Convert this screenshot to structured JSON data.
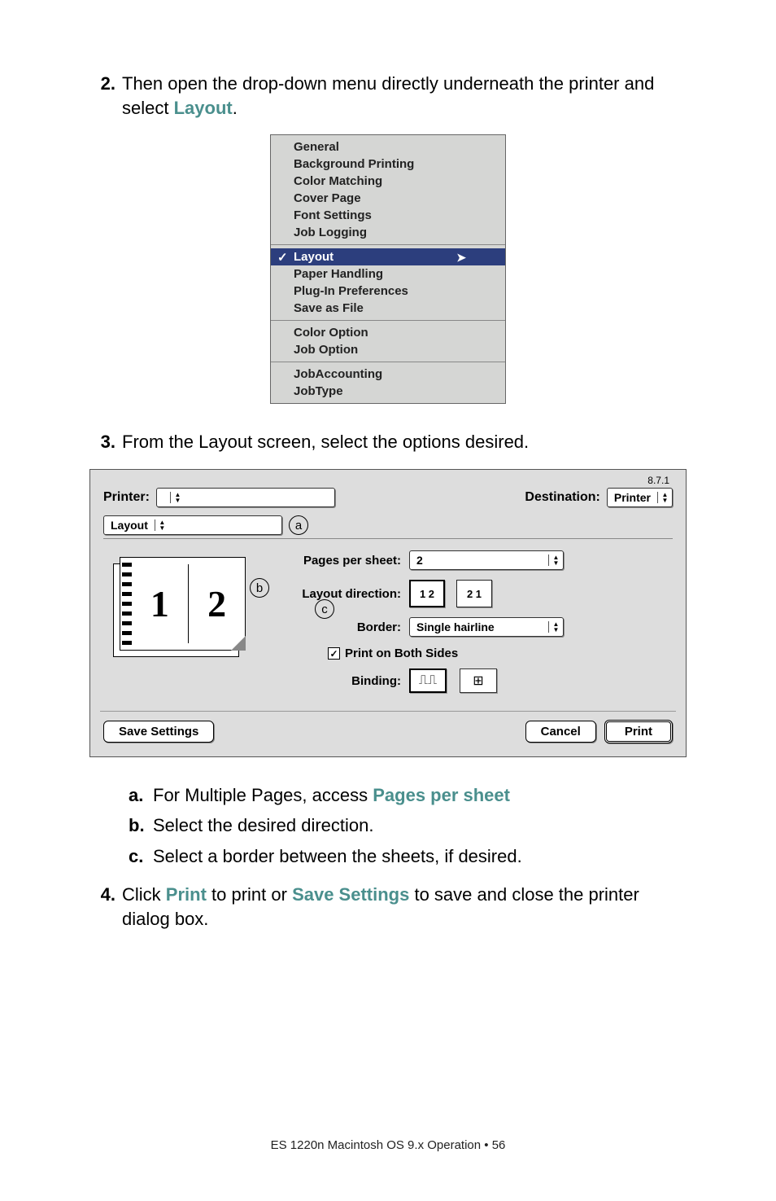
{
  "steps": {
    "s2": {
      "num": "2.",
      "text_a": "Then open the drop-down menu directly underneath the printer and select ",
      "kw": "Layout",
      "text_b": "."
    },
    "s3": {
      "num": "3.",
      "text": "From the Layout screen, select the options desired."
    },
    "s4": {
      "num": "4.",
      "text_a": "Click ",
      "kw1": "Print",
      "text_b": " to print or ",
      "kw2": "Save Settings",
      "text_c": " to save and close the printer dialog box."
    }
  },
  "menu": {
    "g1": [
      "General",
      "Background Printing",
      "Color Matching",
      "Cover Page",
      "Font Settings",
      "Job Logging"
    ],
    "sel": "Layout",
    "g2": [
      "Paper Handling",
      "Plug-In Preferences",
      "Save as File"
    ],
    "g3": [
      "Color Option",
      "Job Option"
    ],
    "g4": [
      "JobAccounting",
      "JobType"
    ]
  },
  "dialog": {
    "version": "8.7.1",
    "printer_lbl": "Printer:",
    "dest_lbl": "Destination:",
    "dest_val": "Printer",
    "section": "Layout",
    "preview": {
      "p1": "1",
      "p2": "2"
    },
    "pps_lbl": "Pages per sheet:",
    "pps_val": "2",
    "dir_lbl": "Layout direction:",
    "dir_a": "1 2",
    "dir_b": "2 1",
    "border_lbl": "Border:",
    "border_val": "Single hairline",
    "both_sides": "Print on Both Sides",
    "binding_lbl": "Binding:",
    "save": "Save Settings",
    "cancel": "Cancel",
    "print": "Print"
  },
  "callouts": {
    "a": "a",
    "b": "b",
    "c": "c"
  },
  "sub": {
    "a": {
      "l": "a.",
      "t1": "For Multiple Pages, access ",
      "kw": "Pages per sheet"
    },
    "b": {
      "l": "b.",
      "t": "Select the desired direction."
    },
    "c": {
      "l": "c.",
      "t": "Select a border between the sheets, if desired."
    }
  },
  "footer": {
    "text": "ES 1220n Macintosh OS 9.x Operation  •  56"
  }
}
